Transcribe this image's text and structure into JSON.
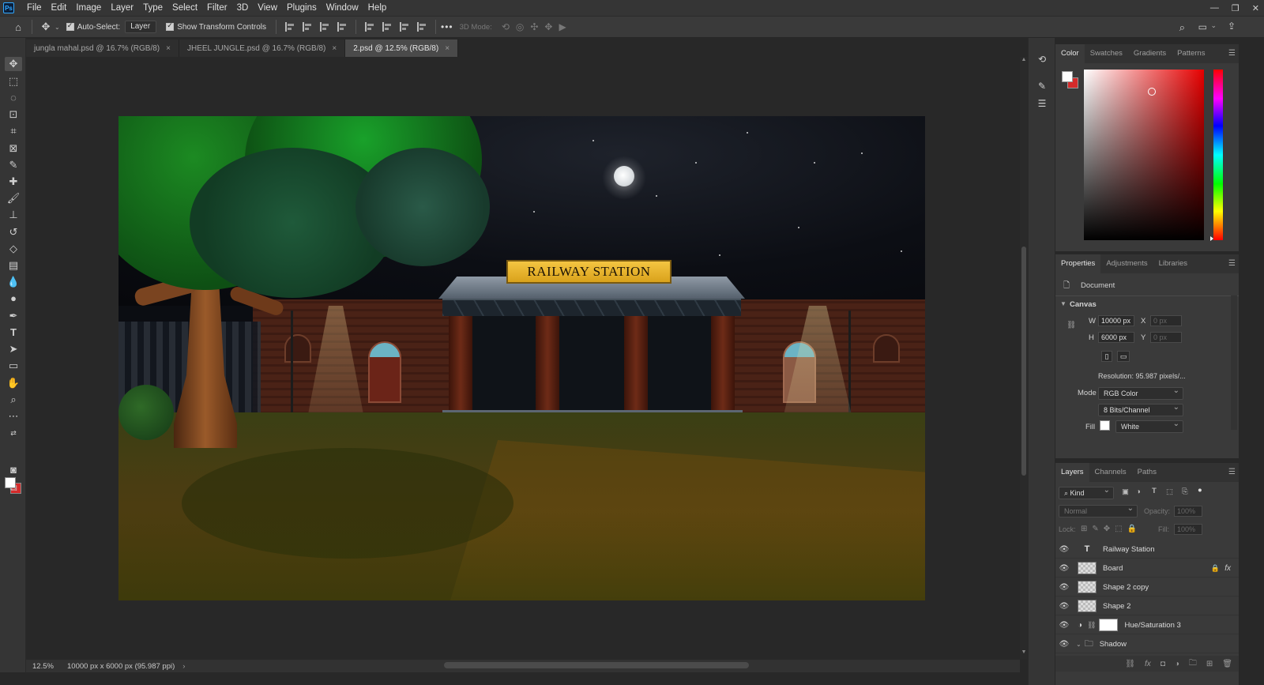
{
  "menubar": {
    "items": [
      "File",
      "Edit",
      "Image",
      "Layer",
      "Type",
      "Select",
      "Filter",
      "3D",
      "View",
      "Plugins",
      "Window",
      "Help"
    ],
    "logo": "Ps"
  },
  "options": {
    "auto_select_label": "Auto-Select:",
    "auto_select_value": "Layer",
    "transform_label": "Show Transform Controls",
    "three_d_label": "3D Mode:",
    "more": "•••"
  },
  "tabs": [
    {
      "label": "jungla mahal.psd @ 16.7% (RGB/8)"
    },
    {
      "label": "JHEEL JUNGLE.psd @ 16.7% (RGB/8)"
    },
    {
      "label": "2.psd @ 12.5% (RGB/8)"
    }
  ],
  "tab_close": "×",
  "canvas": {
    "sign_text": "RAILWAY STATION"
  },
  "status": {
    "zoom": "12.5%",
    "doc_info": "10000 px x 6000 px (95.987 ppi)",
    "arrow": "›"
  },
  "color_panel": {
    "tabs": [
      "Color",
      "Swatches",
      "Gradients",
      "Patterns"
    ],
    "fg": "#ffffff",
    "bg": "#d42b2b"
  },
  "properties": {
    "tabs": [
      "Properties",
      "Adjustments",
      "Libraries"
    ],
    "document_label": "Document",
    "canvas_heading": "Canvas",
    "w_label": "W",
    "w_value": "10000 px",
    "h_label": "H",
    "h_value": "6000 px",
    "x_label": "X",
    "x_value": "0 px",
    "y_label": "Y",
    "y_value": "0 px",
    "resolution": "Resolution:  95.987  pixels/...",
    "mode_label": "Mode",
    "mode_value": "RGB Color",
    "bits_value": "8 Bits/Channel",
    "fill_label": "Fill",
    "fill_value": "White"
  },
  "layers": {
    "tabs": [
      "Layers",
      "Channels",
      "Paths"
    ],
    "filter_kind": "Kind",
    "blend_mode": "Normal",
    "opacity_label": "Opacity:",
    "opacity_value": "100%",
    "lock_label": "Lock:",
    "fill_label": "Fill:",
    "fill_value": "100%",
    "fx": "fx",
    "rows": [
      {
        "name": "Railway Station",
        "kind": "text"
      },
      {
        "name": "Board",
        "kind": "pixel"
      },
      {
        "name": "Shape 2 copy",
        "kind": "pixel"
      },
      {
        "name": "Shape 2",
        "kind": "pixel"
      },
      {
        "name": "Hue/Saturation 3",
        "kind": "adjustment"
      },
      {
        "name": "Shadow",
        "kind": "group"
      }
    ]
  }
}
